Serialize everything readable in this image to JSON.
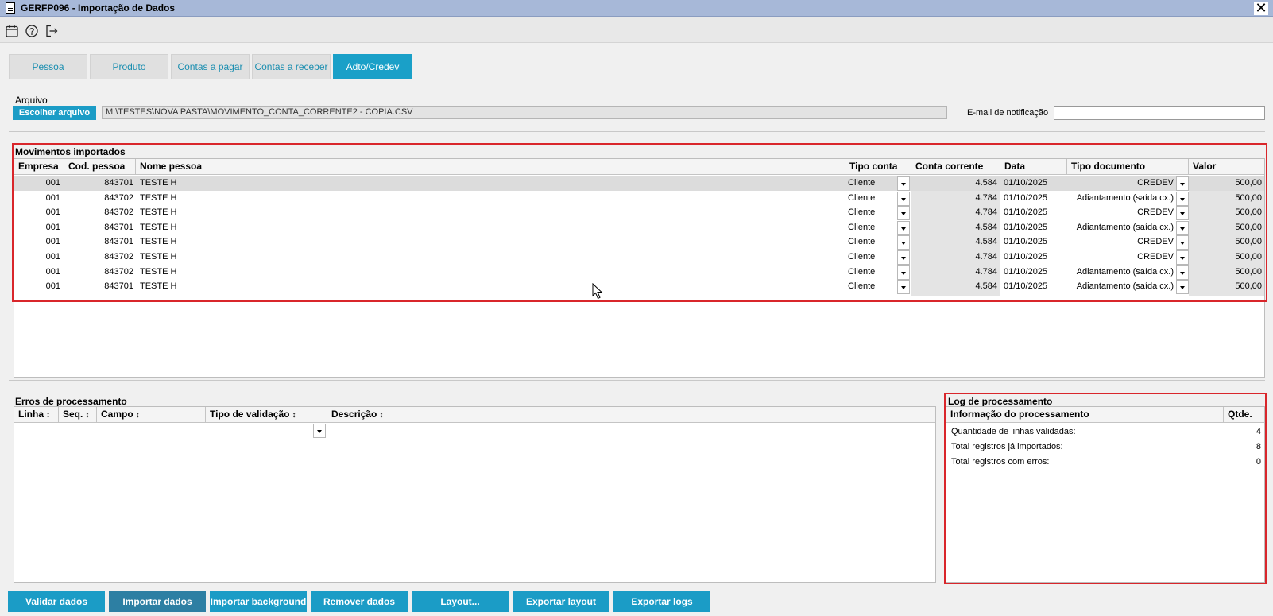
{
  "window": {
    "title": "GERFP096 - Importação de Dados",
    "close_label": "✕"
  },
  "toolbar": {
    "icons": [
      "calendar-icon",
      "help-icon",
      "exit-icon"
    ]
  },
  "tabs": [
    {
      "label": "Pessoa",
      "active": false
    },
    {
      "label": "Produto",
      "active": false
    },
    {
      "label": "Contas a pagar",
      "active": false
    },
    {
      "label": "Contas a receber",
      "active": false
    },
    {
      "label": "Adto/Credev",
      "active": true
    }
  ],
  "arquivo": {
    "section_label": "Arquivo",
    "choose_button_label": "Escolher arquivo",
    "file_path": "M:\\TESTES\\NOVA PASTA\\MOVIMENTO_CONTA_CORRENTE2 - COPIA.CSV",
    "email_label": "E-mail de notificação",
    "email_value": ""
  },
  "movimentos": {
    "section_label": "Movimentos importados",
    "columns": [
      "Empresa",
      "Cod. pessoa",
      "Nome pessoa",
      "Tipo conta",
      "Conta corrente",
      "Data",
      "Tipo documento",
      "Valor"
    ],
    "rows": [
      {
        "empresa": "001",
        "cod": "843701",
        "nome": "TESTE H",
        "tipo_conta": "Cliente",
        "conta": "4.584",
        "data": "01/10/2025",
        "tipo_doc": "CREDEV",
        "valor": "500,00"
      },
      {
        "empresa": "001",
        "cod": "843702",
        "nome": "TESTE H",
        "tipo_conta": "Cliente",
        "conta": "4.784",
        "data": "01/10/2025",
        "tipo_doc": "Adiantamento (saída cx.)",
        "valor": "500,00"
      },
      {
        "empresa": "001",
        "cod": "843702",
        "nome": "TESTE H",
        "tipo_conta": "Cliente",
        "conta": "4.784",
        "data": "01/10/2025",
        "tipo_doc": "CREDEV",
        "valor": "500,00"
      },
      {
        "empresa": "001",
        "cod": "843701",
        "nome": "TESTE H",
        "tipo_conta": "Cliente",
        "conta": "4.584",
        "data": "01/10/2025",
        "tipo_doc": "Adiantamento (saída cx.)",
        "valor": "500,00"
      },
      {
        "empresa": "001",
        "cod": "843701",
        "nome": "TESTE H",
        "tipo_conta": "Cliente",
        "conta": "4.584",
        "data": "01/10/2025",
        "tipo_doc": "CREDEV",
        "valor": "500,00"
      },
      {
        "empresa": "001",
        "cod": "843702",
        "nome": "TESTE H",
        "tipo_conta": "Cliente",
        "conta": "4.784",
        "data": "01/10/2025",
        "tipo_doc": "CREDEV",
        "valor": "500,00"
      },
      {
        "empresa": "001",
        "cod": "843702",
        "nome": "TESTE H",
        "tipo_conta": "Cliente",
        "conta": "4.784",
        "data": "01/10/2025",
        "tipo_doc": "Adiantamento (saída cx.)",
        "valor": "500,00"
      },
      {
        "empresa": "001",
        "cod": "843701",
        "nome": "TESTE H",
        "tipo_conta": "Cliente",
        "conta": "4.584",
        "data": "01/10/2025",
        "tipo_doc": "Adiantamento (saída cx.)",
        "valor": "500,00"
      }
    ]
  },
  "erros": {
    "section_label": "Erros de processamento",
    "columns": [
      "Linha",
      "Seq.",
      "Campo",
      "Tipo de validação",
      "Descrição"
    ]
  },
  "log": {
    "section_label": "Log de processamento",
    "columns": [
      "Informação do processamento",
      "Qtde."
    ],
    "rows": [
      {
        "info": "Quantidade de linhas validadas:",
        "qtde": "4"
      },
      {
        "info": "Total registros já importados:",
        "qtde": "8"
      },
      {
        "info": "Total registros com erros:",
        "qtde": "0"
      }
    ]
  },
  "footer": {
    "buttons": [
      "Validar dados",
      "Importar dados",
      "Importar background",
      "Remover dados",
      "Layout...",
      "Exportar layout",
      "Exportar logs"
    ]
  },
  "colors": {
    "accent": "#1b9cc6",
    "highlight": "#d9262b",
    "titlebar": "#a7b8d8"
  }
}
